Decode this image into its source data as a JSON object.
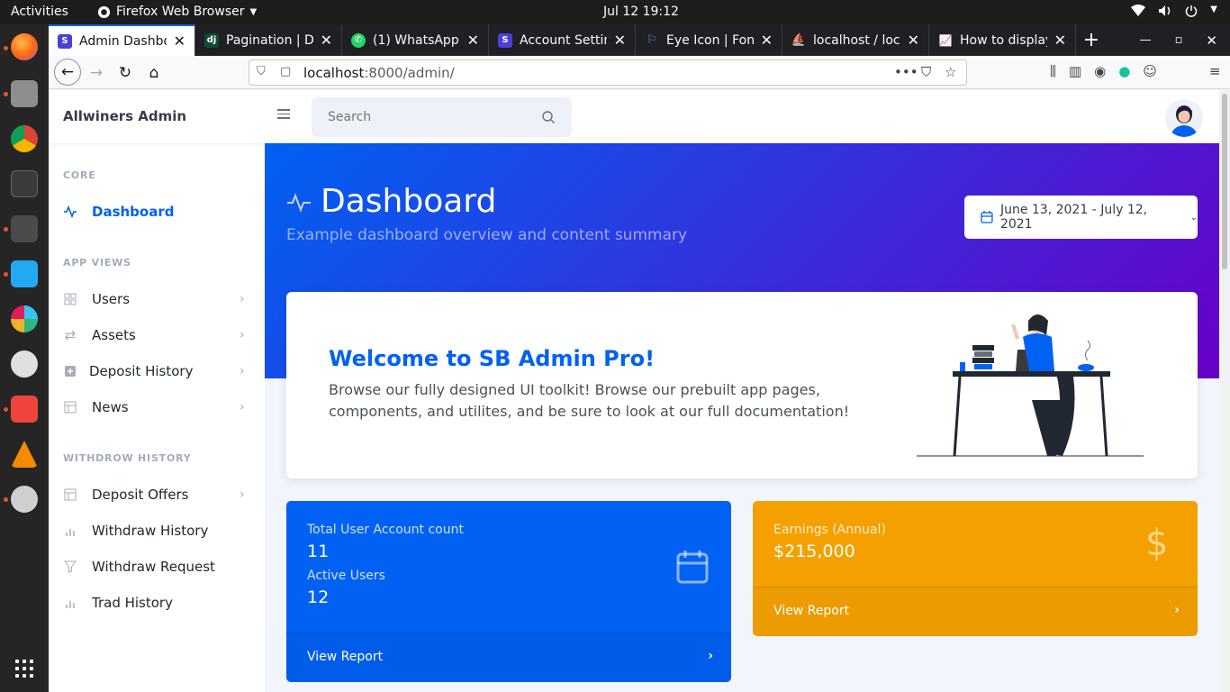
{
  "os": {
    "activities": "Activities",
    "app_menu": "Firefox Web Browser",
    "clock": "Jul 12  19:12"
  },
  "browser": {
    "tabs": [
      {
        "label": "Admin Dashboa",
        "icon": "sb-admin-icon",
        "icon_color": "#4a3fd8",
        "active": true
      },
      {
        "label": "Pagination | Dja",
        "icon": "django-icon",
        "icon_color": "#0c4b33",
        "active": false
      },
      {
        "label": "(1) WhatsApp",
        "icon": "whatsapp-icon",
        "icon_color": "#25d366",
        "active": false
      },
      {
        "label": "Account Settinc",
        "icon": "sb-admin-icon",
        "icon_color": "#4a3fd8",
        "active": false
      },
      {
        "label": "Eye Icon | Font",
        "icon": "flag-icon",
        "icon_color": "#528dd7",
        "active": false
      },
      {
        "label": "localhost / loca",
        "icon": "phpmyadmin-icon",
        "icon_color": "#e9883a",
        "active": false
      },
      {
        "label": "How to display",
        "icon": "chart-icon",
        "icon_color": "#3b5bdb",
        "active": false
      }
    ],
    "url_host": "localhost",
    "url_path": ":8000/admin/"
  },
  "app": {
    "brand": "Allwiners Admin",
    "search_placeholder": "Search",
    "sidebar": {
      "sections": [
        "CORE",
        "APP VIEWS",
        "WITHDROW HISTORY"
      ],
      "items": [
        {
          "label": "Dashboard",
          "icon": "activity-icon",
          "active": true,
          "chevron": false
        },
        {
          "label": "Users",
          "icon": "grid-icon",
          "active": false,
          "chevron": true
        },
        {
          "label": "Assets",
          "icon": "repeat-icon",
          "active": false,
          "chevron": true
        },
        {
          "label": "Deposit History",
          "icon": "plus-square-icon",
          "active": false,
          "chevron": true
        },
        {
          "label": "News",
          "icon": "layout-icon",
          "active": false,
          "chevron": true
        },
        {
          "label": "Deposit Offers",
          "icon": "layout-icon",
          "active": false,
          "chevron": true
        },
        {
          "label": "Withdraw History",
          "icon": "bar-chart-icon",
          "active": false,
          "chevron": false
        },
        {
          "label": "Withdraw Request",
          "icon": "filter-icon",
          "active": false,
          "chevron": false
        },
        {
          "label": "Trad History",
          "icon": "bar-chart-icon",
          "active": false,
          "chevron": false
        }
      ]
    },
    "hero": {
      "title": "Dashboard",
      "subtitle": "Example dashboard overview and content summary",
      "date_range": "June 13, 2021 - July 12, 2021"
    },
    "welcome": {
      "title": "Welcome to SB Admin Pro!",
      "text": "Browse our fully designed UI toolkit! Browse our prebuilt app pages, components, and utilites, and be sure to look at our full documentation!"
    },
    "cards": {
      "users": {
        "label1": "Total User Account count",
        "value1": "11",
        "label2": "Active Users",
        "value2": "12",
        "footer": "View Report",
        "color": "#0061f2"
      },
      "earnings": {
        "label": "Earnings (Annual)",
        "value": "$215,000",
        "footer": "View Report",
        "color": "#f4a100"
      }
    }
  }
}
